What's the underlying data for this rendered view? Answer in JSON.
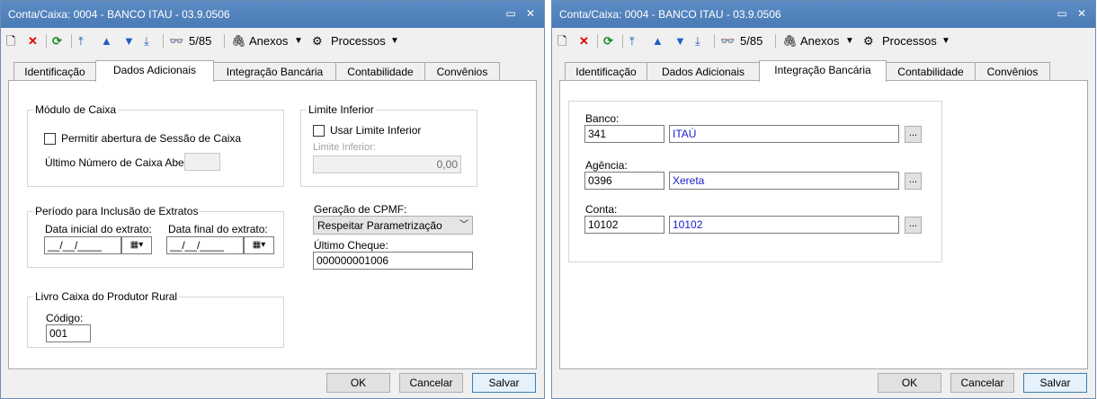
{
  "left": {
    "title": "Conta/Caixa: 0004 - BANCO ITAU - 03.9.0506",
    "toolbar": {
      "record": "5/85",
      "anexos": "Anexos",
      "processos": "Processos"
    },
    "tabs": [
      "Identificação",
      "Dados Adicionais",
      "Integração Bancária",
      "Contabilidade",
      "Convênios"
    ],
    "active_tab": "Dados Adicionais",
    "modulo_caixa": {
      "title": "Módulo de Caixa",
      "permitir_label": "Permitir abertura de Sessão de Caixa",
      "ultimo_numero_label": "Último Número de Caixa Aberto:",
      "ultimo_numero_value": ""
    },
    "limite_inferior": {
      "title": "Limite Inferior",
      "usar_label": "Usar Limite Inferior",
      "field_label": "Limite Inferior:",
      "value": "0,00"
    },
    "periodo": {
      "title": "Período para Inclusão de Extratos",
      "data_inicial_label": "Data inicial do extrato:",
      "data_inicial_value": "__/__/____",
      "data_final_label": "Data final do extrato:",
      "data_final_value": "__/__/____"
    },
    "cpmf": {
      "label": "Geração de CPMF:",
      "selected": "Respeitar Parametrização",
      "ultimo_cheque_label": "Último Cheque:",
      "ultimo_cheque_value": "000000001006"
    },
    "livro": {
      "title": "Livro Caixa do Produtor Rural",
      "codigo_label": "Código:",
      "codigo_value": "001"
    },
    "buttons": {
      "ok": "OK",
      "cancelar": "Cancelar",
      "salvar": "Salvar"
    }
  },
  "right": {
    "title": "Conta/Caixa: 0004 - BANCO ITAU - 03.9.0506",
    "toolbar": {
      "record": "5/85",
      "anexos": "Anexos",
      "processos": "Processos"
    },
    "tabs": [
      "Identificação",
      "Dados Adicionais",
      "Integração Bancária",
      "Contabilidade",
      "Convênios"
    ],
    "active_tab": "Integração Bancária",
    "banco": {
      "label": "Banco:",
      "code": "341",
      "name": "ITAÚ"
    },
    "agencia": {
      "label": "Agência:",
      "code": "0396",
      "name": "Xereta"
    },
    "conta": {
      "label": "Conta:",
      "code": "10102",
      "name": "10102"
    },
    "buttons": {
      "ok": "OK",
      "cancelar": "Cancelar",
      "salvar": "Salvar"
    }
  },
  "colors": {
    "titlebar": "#5b8cc4",
    "link_text": "#1a1acc"
  }
}
